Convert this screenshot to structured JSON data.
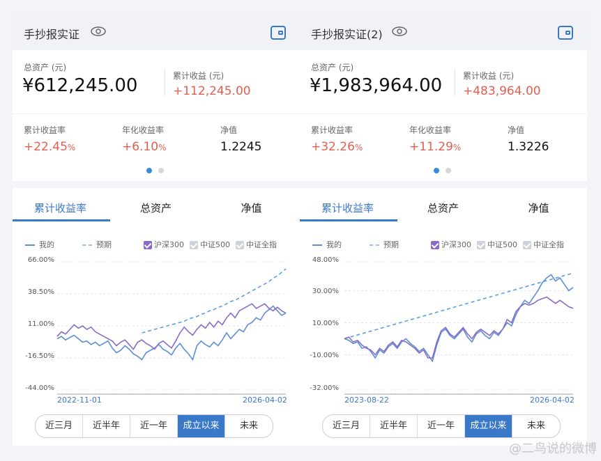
{
  "panels": [
    {
      "title": "手抄报实证",
      "total_assets_label": "总资产 (元)",
      "total_assets": "¥612,245.00",
      "cum_income_label": "累计收益 (元)",
      "cum_income": "+112,245.00",
      "cum_rate_label": "累计收益率",
      "cum_rate": "+22.45",
      "ann_rate_label": "年化收益率",
      "ann_rate": "+6.10",
      "nav_label": "净值",
      "nav": "1.2245",
      "percent_sign": "%",
      "tabs": [
        "累计收益率",
        "总资产",
        "净值"
      ],
      "legend": {
        "mine": "我的",
        "expected": "预期",
        "b1": "沪深300",
        "b2": "中证500",
        "b3": "中证全指"
      },
      "ranges": [
        "近三月",
        "近半年",
        "近一年",
        "成立以来",
        "未来"
      ],
      "active_range": "成立以来",
      "chart_data": {
        "type": "line",
        "y_ticks": [
          "66.00%",
          "38.50%",
          "11.00%",
          "-16.50%",
          "-44.00%"
        ],
        "ylim": [
          -44,
          66
        ],
        "x_start": "2022-11-01",
        "x_end": "2026-04-02",
        "series": [
          {
            "name": "我的",
            "color": "#5b8ed6",
            "values": [
              0,
              2,
              -1,
              1,
              3,
              0,
              -3,
              -2,
              -5,
              -3,
              -6,
              -4,
              -2,
              -8,
              -12,
              -10,
              -6,
              -9,
              -13,
              -15,
              -18,
              -12,
              -10,
              -8,
              -5,
              -9,
              -11,
              -14,
              -8,
              -4,
              -9,
              -13,
              -18,
              -6,
              -2,
              -5,
              -7,
              -3,
              -6,
              -1,
              5,
              0,
              4,
              8,
              6,
              12,
              14,
              18,
              16,
              22,
              25,
              28,
              24,
              20,
              22
            ]
          },
          {
            "name": "预期",
            "color": "#5b9ee0",
            "dashed": true,
            "values_from_index": 20,
            "values": [
              5,
              6,
              7,
              8,
              9,
              10,
              11,
              12,
              13,
              14,
              15,
              17,
              18,
              19,
              21,
              22,
              24,
              25,
              27,
              28,
              30,
              32,
              33,
              35,
              37,
              39,
              41,
              43,
              45,
              47,
              49,
              52,
              54,
              57,
              60
            ]
          },
          {
            "name": "沪深300",
            "color": "#8a6bc8",
            "values": [
              2,
              6,
              4,
              8,
              12,
              9,
              11,
              8,
              10,
              6,
              4,
              2,
              0,
              -2,
              -6,
              -3,
              -1,
              -5,
              -9,
              -3,
              -1,
              -4,
              -6,
              -9,
              -4,
              -2,
              -5,
              -8,
              -2,
              5,
              10,
              6,
              3,
              8,
              12,
              9,
              14,
              10,
              15,
              12,
              18,
              22,
              18,
              24,
              26,
              28,
              30,
              26,
              28,
              30,
              26,
              24,
              27,
              24,
              22
            ]
          }
        ]
      }
    },
    {
      "title": "手抄报实证(2)",
      "total_assets_label": "总资产 (元)",
      "total_assets": "¥1,983,964.00",
      "cum_income_label": "累计收益 (元)",
      "cum_income": "+483,964.00",
      "cum_rate_label": "累计收益率",
      "cum_rate": "+32.26",
      "ann_rate_label": "年化收益率",
      "ann_rate": "+11.29",
      "nav_label": "净值",
      "nav": "1.3226",
      "percent_sign": "%",
      "tabs": [
        "累计收益率",
        "总资产",
        "净值"
      ],
      "legend": {
        "mine": "我的",
        "expected": "预期",
        "b1": "沪深300",
        "b2": "中证500",
        "b3": "中证全指"
      },
      "ranges": [
        "近三月",
        "近半年",
        "近一年",
        "成立以来",
        "未来"
      ],
      "active_range": "成立以来",
      "chart_data": {
        "type": "line",
        "y_ticks": [
          "48.00%",
          "30.00%",
          "10.00%",
          "-10.00%",
          "-32.00%"
        ],
        "ylim": [
          -32,
          48
        ],
        "x_start": "2023-08-22",
        "x_end": "2026-04-02",
        "series": [
          {
            "name": "我的",
            "color": "#5b8ed6",
            "values": [
              0,
              -1,
              -3,
              -2,
              -6,
              -5,
              -8,
              -12,
              -7,
              -9,
              -5,
              -3,
              -6,
              -2,
              0,
              -3,
              -5,
              -8,
              -6,
              -10,
              -14,
              -4,
              4,
              6,
              2,
              0,
              3,
              6,
              1,
              -2,
              3,
              5,
              2,
              0,
              4,
              2,
              6,
              10,
              8,
              15,
              20,
              24,
              22,
              26,
              30,
              35,
              38,
              40,
              36,
              38,
              34,
              30,
              32
            ]
          },
          {
            "name": "预期",
            "color": "#5b9ee0",
            "dashed": true,
            "values_from_index": 0,
            "values": [
              0,
              1,
              2,
              3,
              4,
              5,
              6,
              7,
              8,
              9,
              10,
              11,
              12,
              13,
              14,
              15,
              16,
              17,
              18,
              19,
              20,
              21,
              22,
              23,
              24,
              25,
              26,
              27,
              28,
              29,
              30,
              31,
              32,
              33,
              34,
              35,
              36,
              37,
              38,
              39,
              40,
              41
            ]
          },
          {
            "name": "沪深300",
            "color": "#8a6bc8",
            "values": [
              0,
              1,
              -2,
              -1,
              -4,
              -6,
              -7,
              -10,
              -6,
              -8,
              -4,
              -2,
              -5,
              -1,
              -2,
              -4,
              -6,
              -9,
              -7,
              -12,
              -12,
              -2,
              5,
              7,
              3,
              1,
              4,
              7,
              3,
              0,
              4,
              6,
              4,
              2,
              5,
              3,
              6,
              12,
              10,
              17,
              20,
              22,
              21,
              22,
              24,
              25,
              26,
              24,
              22,
              24,
              22,
              20,
              19
            ]
          }
        ]
      }
    }
  ],
  "watermark": "@二鸟说的微博"
}
